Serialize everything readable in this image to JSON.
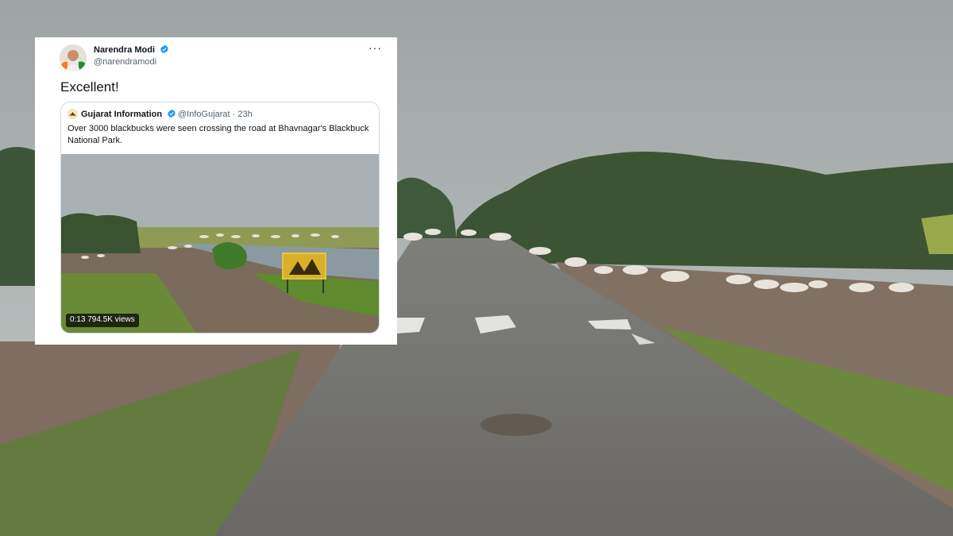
{
  "tweet": {
    "author_name": "Narendra Modi",
    "author_handle": "@narendramodi",
    "more_label": "···",
    "text": "Excellent!",
    "quoted": {
      "author_name": "Gujarat Information",
      "author_handle": "@InfoGujarat",
      "separator": "·",
      "time_ago": "23h",
      "text": "Over 3000 blackbucks were seen crossing the road at Bhavnagar's Blackbuck National Park.",
      "video": {
        "duration": "0:13",
        "views": "794.5K views"
      }
    }
  },
  "colors": {
    "verified": "#1d9bf0",
    "secondary_text": "#536471",
    "card_border": "#cfd9de"
  },
  "icons": [
    "verified-badge-icon",
    "more-options-icon"
  ]
}
